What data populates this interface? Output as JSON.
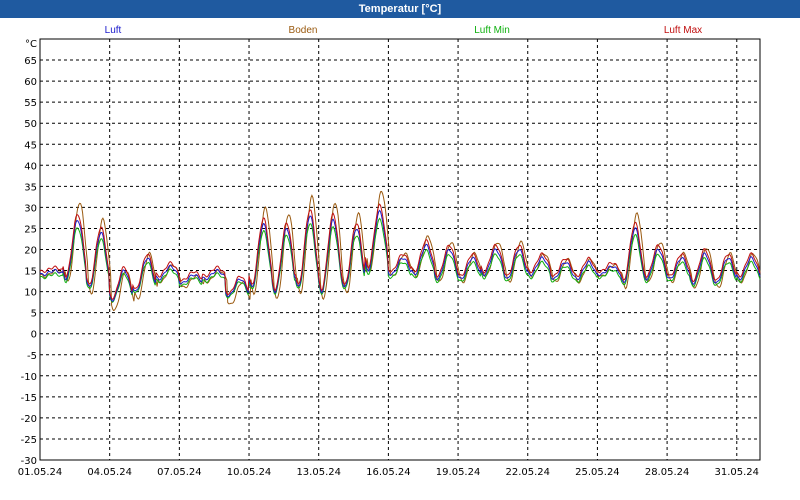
{
  "window": {
    "title": "Temperatur [°C]"
  },
  "legend": [
    {
      "name": "Luft",
      "color": "#1a1acc"
    },
    {
      "name": "Boden",
      "color": "#9a5a10"
    },
    {
      "name": "Luft Min",
      "color": "#10b010"
    },
    {
      "name": "Luft Max",
      "color": "#c01010"
    }
  ],
  "chart_data": {
    "type": "line",
    "title": "Temperatur [°C]",
    "ylabel": "°C",
    "ylim": [
      -30,
      70
    ],
    "yticks": [
      -30,
      -25,
      -20,
      -15,
      -10,
      -5,
      0,
      5,
      10,
      15,
      20,
      25,
      30,
      35,
      40,
      45,
      50,
      55,
      60,
      65
    ],
    "xlim": [
      "01.05.24",
      "01.06.24"
    ],
    "xticks": [
      "01.05.24",
      "04.05.24",
      "07.05.24",
      "10.05.24",
      "13.05.24",
      "16.05.24",
      "19.05.24",
      "22.05.24",
      "25.05.24",
      "28.05.24",
      "31.05.24"
    ],
    "grid": true,
    "legend_position": "top",
    "daily_min": [
      14,
      13,
      11,
      8,
      10,
      13,
      12,
      13,
      9,
      11,
      10,
      11,
      10,
      11,
      15,
      14,
      14,
      13,
      13,
      14,
      13,
      14,
      13,
      13,
      14,
      12,
      13,
      13,
      12,
      12,
      13
    ],
    "daily_max": [
      15,
      27,
      24,
      15,
      18,
      16,
      14,
      15,
      13,
      26,
      25,
      28,
      27,
      25,
      29,
      18,
      21,
      20,
      18,
      20,
      20,
      18,
      17,
      17,
      16,
      25,
      20,
      18,
      19,
      18,
      18
    ],
    "series": [
      {
        "name": "Luft",
        "color": "#1a1acc"
      },
      {
        "name": "Boden",
        "color": "#9a5a10"
      },
      {
        "name": "Luft Min",
        "color": "#10b010"
      },
      {
        "name": "Luft Max",
        "color": "#c01010"
      }
    ]
  }
}
